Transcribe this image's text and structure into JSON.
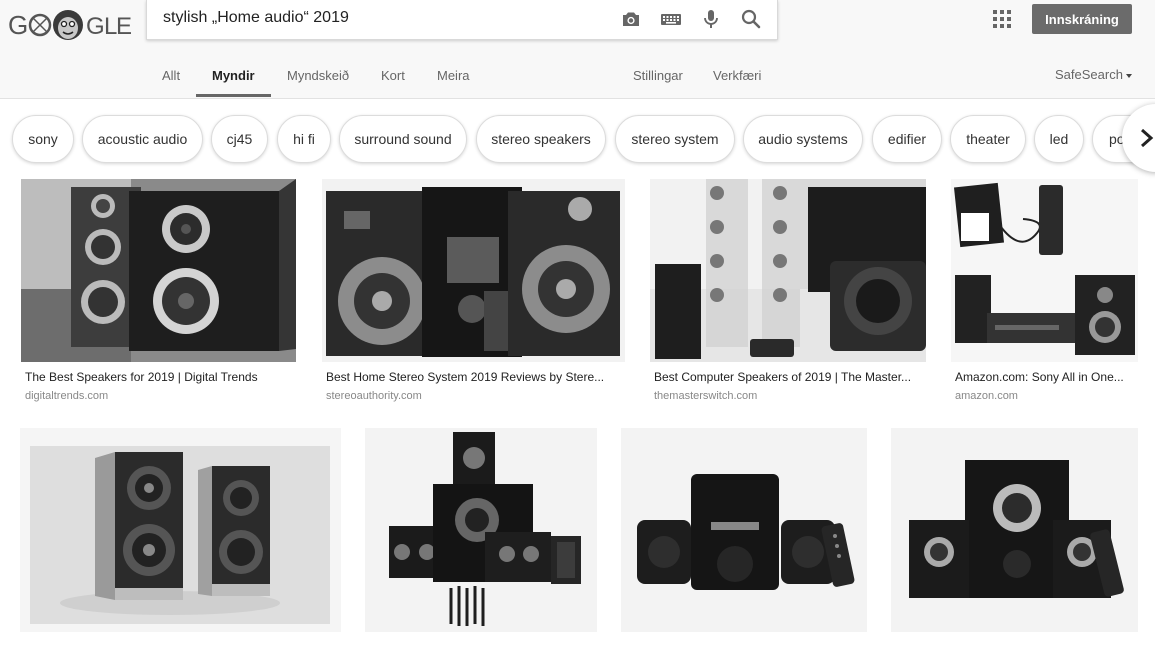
{
  "logo": {
    "text": "GOOGLE"
  },
  "search": {
    "query": "stylish „Home audio“ 2019"
  },
  "icons": {
    "camera": "camera-icon",
    "keyboard": "keyboard-icon",
    "mic": "microphone-icon",
    "search": "search-icon",
    "apps": "apps-grid-icon",
    "next": "chevron-right-icon"
  },
  "header": {
    "signin_label": "Innskráning"
  },
  "tabs": [
    {
      "label": "Allt"
    },
    {
      "label": "Myndir"
    },
    {
      "label": "Myndskeið"
    },
    {
      "label": "Kort"
    },
    {
      "label": "Meira"
    },
    {
      "label": "Stillingar"
    },
    {
      "label": "Verkfæri"
    }
  ],
  "safesearch": {
    "label": "SafeSearch"
  },
  "chips": [
    "sony",
    "acoustic audio",
    "cj45",
    "hi fi",
    "surround sound",
    "stereo speakers",
    "stereo system",
    "audio systems",
    "edifier",
    "theater",
    "led",
    "pol"
  ],
  "results_row1": [
    {
      "title": "The Best Speakers for 2019 | Digital Trends",
      "site": "digitaltrends.com"
    },
    {
      "title": "Best Home Stereo System 2019 Reviews by Stere...",
      "site": "stereoauthority.com"
    },
    {
      "title": "Best Computer Speakers of 2019 | The Master...",
      "site": "themasterswitch.com"
    },
    {
      "title": "Amazon.com: Sony All in One...",
      "site": "amazon.com"
    }
  ],
  "colors": {
    "accent_tab": "#666666",
    "signin_bg": "#6b6b6b"
  }
}
